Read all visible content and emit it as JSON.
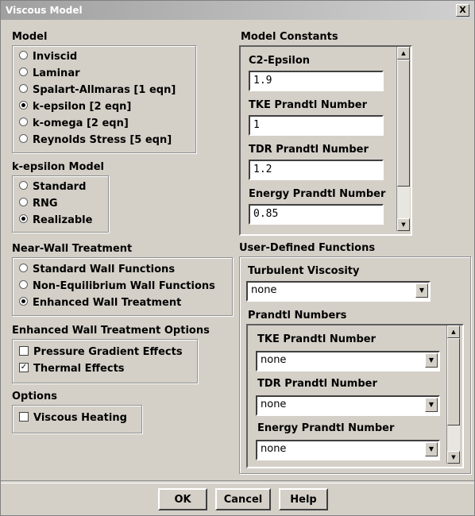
{
  "window": {
    "title": "Viscous Model",
    "close_glyph": "X"
  },
  "model": {
    "label": "Model",
    "options": [
      {
        "label": "Inviscid",
        "selected": false
      },
      {
        "label": "Laminar",
        "selected": false
      },
      {
        "label": "Spalart-Allmaras   [1 eqn]",
        "selected": false
      },
      {
        "label": "k-epsilon   [2 eqn]",
        "selected": true
      },
      {
        "label": "k-omega   [2 eqn]",
        "selected": false
      },
      {
        "label": "Reynolds Stress   [5 eqn]",
        "selected": false
      }
    ]
  },
  "keps_model": {
    "label": "k-epsilon Model",
    "options": [
      {
        "label": "Standard",
        "selected": false
      },
      {
        "label": "RNG",
        "selected": false
      },
      {
        "label": "Realizable",
        "selected": true
      }
    ]
  },
  "near_wall": {
    "label": "Near-Wall Treatment",
    "options": [
      {
        "label": "Standard Wall Functions",
        "selected": false
      },
      {
        "label": "Non-Equilibrium Wall Functions",
        "selected": false
      },
      {
        "label": "Enhanced Wall Treatment",
        "selected": true
      }
    ]
  },
  "enhanced_options": {
    "label": "Enhanced Wall Treatment Options",
    "options": [
      {
        "label": "Pressure Gradient Effects",
        "checked": false
      },
      {
        "label": "Thermal Effects",
        "checked": true
      }
    ]
  },
  "options": {
    "label": "Options",
    "items": [
      {
        "label": "Viscous Heating",
        "checked": false
      }
    ]
  },
  "model_constants": {
    "label": "Model Constants",
    "fields": [
      {
        "label": "C2-Epsilon",
        "value": "1.9"
      },
      {
        "label": "TKE Prandtl Number",
        "value": "1"
      },
      {
        "label": "TDR Prandtl Number",
        "value": "1.2"
      },
      {
        "label": "Energy Prandtl Number",
        "value": "0.85"
      }
    ]
  },
  "udf": {
    "label": "User-Defined Functions",
    "turbulent_viscosity": {
      "label": "Turbulent Viscosity",
      "value": "none"
    },
    "prandtl": {
      "label": "Prandtl Numbers",
      "fields": [
        {
          "label": "TKE Prandtl Number",
          "value": "none"
        },
        {
          "label": "TDR Prandtl Number",
          "value": "none"
        },
        {
          "label": "Energy Prandtl Number",
          "value": "none"
        }
      ]
    }
  },
  "buttons": {
    "ok": "OK",
    "cancel": "Cancel",
    "help": "Help"
  },
  "glyphs": {
    "up": "▲",
    "down": "▼",
    "check": "✓"
  }
}
